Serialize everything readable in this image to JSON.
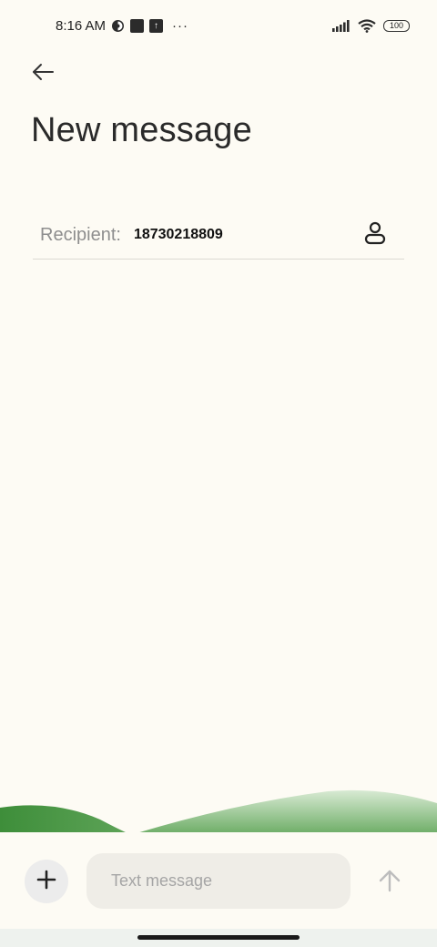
{
  "status_bar": {
    "time": "8:16 AM",
    "more": "···",
    "battery": "100",
    "icons": [
      "data-saver-icon",
      "notification-square-icon",
      "upload-icon",
      "signal-icon",
      "wifi-icon",
      "battery-icon"
    ]
  },
  "header": {
    "back_icon": "arrow-left-icon",
    "title": "New message"
  },
  "recipient": {
    "label": "Recipient:",
    "value": "18730218809",
    "contact_icon": "person-icon"
  },
  "composer": {
    "add_icon": "plus-icon",
    "placeholder": "Text message",
    "value": "",
    "send_icon": "arrow-up-icon"
  },
  "colors": {
    "background": "#fdfbf4",
    "hill_dark": "#3f8f3c",
    "hill_light": "#8fc38a",
    "input_bg": "#efede7"
  }
}
